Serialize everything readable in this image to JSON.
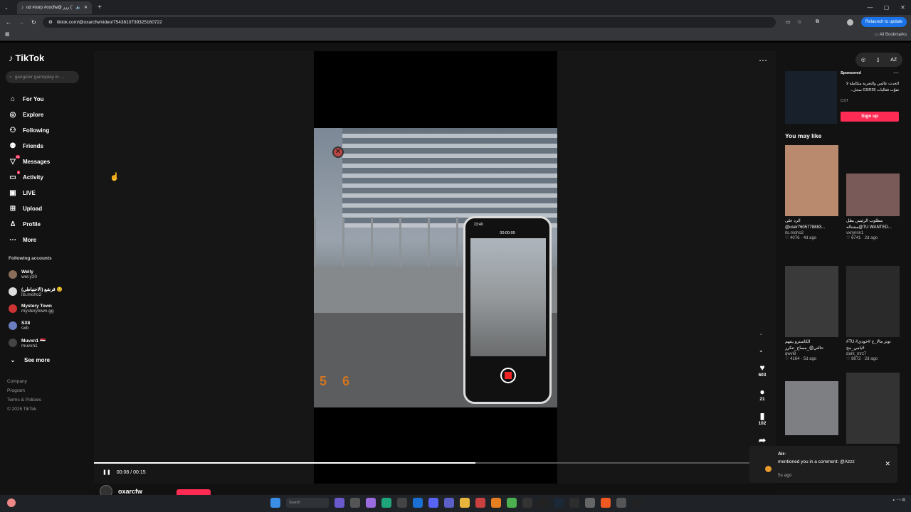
{
  "browser": {
    "tab_title": "od #oxrp #oxcfw@ الرد(76) ررر",
    "url": "tiktok.com/@oxarcfw/video/7543810739325160722",
    "relaunch_label": "Relaunch to update",
    "bookmarks_label": "All Bookmarks"
  },
  "sidebar": {
    "logo": "TikTok",
    "search_placeholder": "gangster gameplay in ...",
    "nav": [
      {
        "label": "For You",
        "icon": "home-icon",
        "glyph": "⌂"
      },
      {
        "label": "Explore",
        "icon": "compass-icon",
        "glyph": "◎"
      },
      {
        "label": "Following",
        "icon": "following-icon",
        "glyph": "⚇"
      },
      {
        "label": "Friends",
        "icon": "friends-icon",
        "glyph": "⚉"
      },
      {
        "label": "Messages",
        "icon": "messages-icon",
        "glyph": "▽",
        "badge": "71"
      },
      {
        "label": "Activity",
        "icon": "activity-icon",
        "glyph": "▭",
        "badge": "5"
      },
      {
        "label": "LIVE",
        "icon": "live-icon",
        "glyph": "▣"
      },
      {
        "label": "Upload",
        "icon": "upload-icon",
        "glyph": "⊞"
      },
      {
        "label": "Profile",
        "icon": "profile-icon",
        "glyph": "∆"
      },
      {
        "label": "More",
        "icon": "more-icon",
        "glyph": "⋯"
      }
    ],
    "following_title": "Following accounts",
    "following": [
      {
        "name": "Welly",
        "handle": "wel.y20"
      },
      {
        "name": "قرشع (الاحتياطي) 😊",
        "handle": "its.moho2"
      },
      {
        "name": "Mystery Town",
        "handle": "mysterytown.gg"
      },
      {
        "name": "SX8",
        "handle": "sxb"
      },
      {
        "name": "Muvxn1 🇾🇪",
        "handle": "muvxn1"
      }
    ],
    "see_more": "See more",
    "footer": [
      "Company",
      "Program",
      "Terms & Policies",
      "© 2025 TikTok"
    ]
  },
  "player": {
    "score_left": "5",
    "score_right": "6",
    "phone_time": "23:40",
    "phone_rec": "00:00:09",
    "likes": "603",
    "comments": "21",
    "saves": "102",
    "progress": 0.56,
    "time": "00:08 / 00:15",
    "author": "oxarcfw"
  },
  "right": {
    "sponsored_label": "Sponsored",
    "sponsored_text": "الحدث عالمي والتجربة متكاملة لا تفوّت فعاليات GSR25 سجل...",
    "sponsored_brand": "CST",
    "signup": "Sign up",
    "you_may_like": "You may like",
    "cards": [
      {
        "caption": "الرد على @user7605778883...",
        "user": "its.moho2",
        "likes": "4076",
        "ago": "4d ago"
      },
      {
        "caption": "مطلوب الرئيس يطل مشتاله@TU WANTED...",
        "user": "vxrynnn1",
        "likes": "6741",
        "ago": "2d ago"
      },
      {
        "caption": "الكاسترو ينتهم حالتي@_مساج_تنكرز",
        "user": "qwvi8",
        "likes": "4164",
        "ago": "5d ago"
      },
      {
        "caption": "#TU #تونز مالا_ج #خودي #يامي_مح",
        "user": "dark_mrz7",
        "likes": "8872",
        "ago": "2d ago"
      }
    ]
  },
  "notification": {
    "name": "Air-",
    "text": "mentioned you in a comment: @Azzz",
    "ago": "5s ago"
  },
  "taskbar": {
    "search": "Search"
  }
}
